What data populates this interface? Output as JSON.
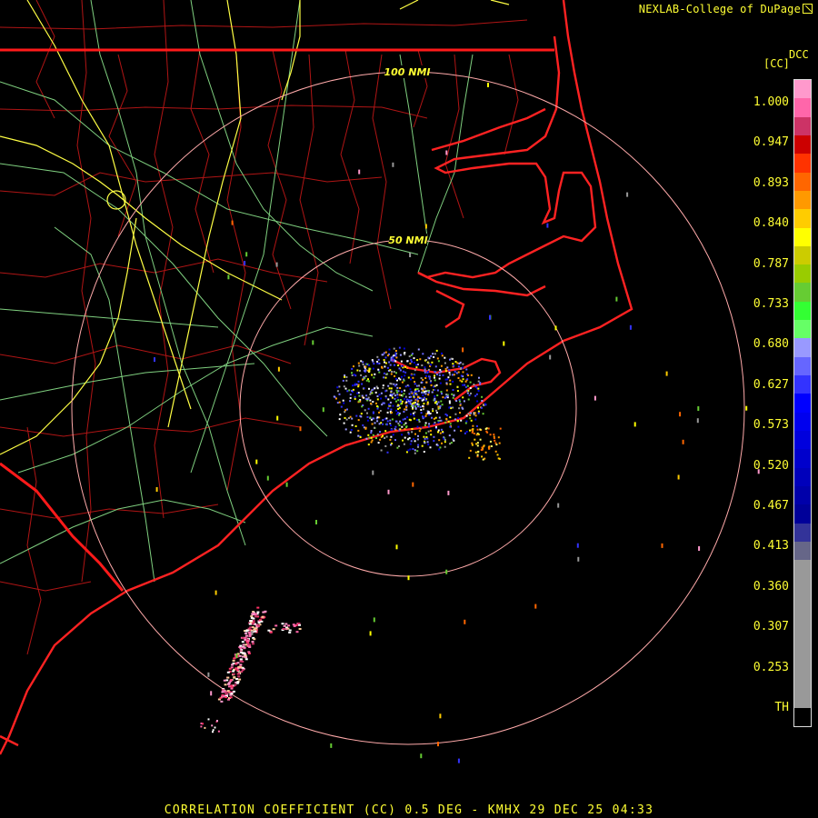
{
  "header": {
    "credit": "NEXLAB-College of DuPage",
    "credit_icon": "external-link-icon"
  },
  "legend": {
    "code": "DCC",
    "product": "[CC]",
    "ticks": [
      "1.000",
      "0.947",
      "0.893",
      "0.840",
      "0.787",
      "0.733",
      "0.680",
      "0.627",
      "0.573",
      "0.520",
      "0.467",
      "0.413",
      "0.360",
      "0.307",
      "0.253",
      "TH"
    ],
    "colors": [
      "#ff99cc",
      "#ff66aa",
      "#cc3366",
      "#cc0000",
      "#ff3300",
      "#ff6600",
      "#ff9900",
      "#ffcc00",
      "#ffff00",
      "#cccc00",
      "#99cc00",
      "#66cc33",
      "#33ff33",
      "#66ff66",
      "#9999ff",
      "#6666ff",
      "#3333ff",
      "#0000ff",
      "#0000ee",
      "#0000dd",
      "#0000cc",
      "#0000bb",
      "#0000aa",
      "#000099",
      "#333399",
      "#666688",
      "#999999",
      "#999999",
      "#999999",
      "#999999",
      "#999999",
      "#999999",
      "#999999",
      "#999999",
      "#000000"
    ]
  },
  "map": {
    "range_rings": [
      "100 NMI",
      "50 NMI"
    ],
    "colors": {
      "state_border": "#ff1a1a",
      "county_border": "#cc1111",
      "coastline": "#ff2222",
      "highway_primary": "#ffff44",
      "highway_secondary": "#88dd88",
      "range_ring": "#ffaaaa"
    }
  },
  "footer": {
    "title": "CORRELATION COEFFICIENT (CC) 0.5 DEG - KMHX 29 DEC 25 04:33"
  }
}
